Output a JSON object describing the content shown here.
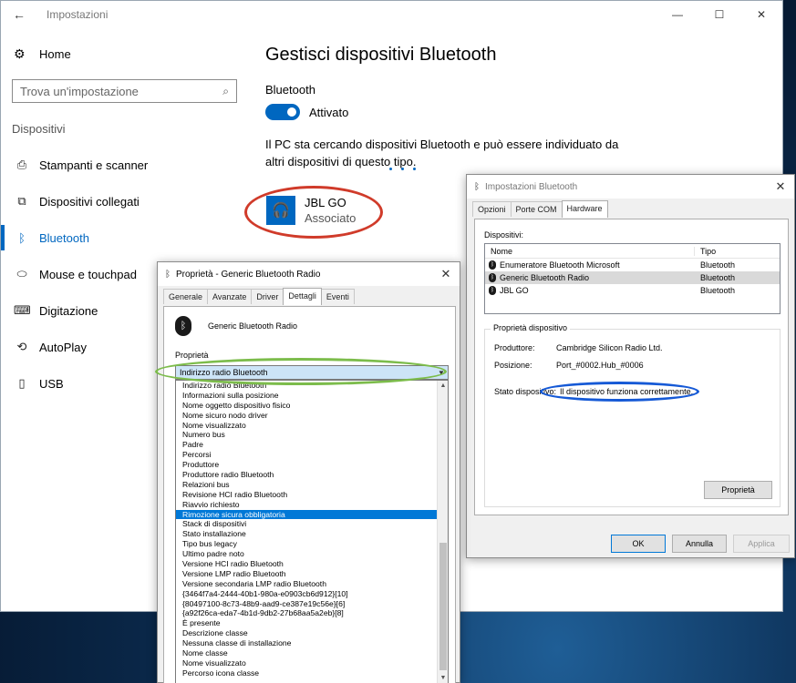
{
  "settings": {
    "window_title": "Impostazioni",
    "back": "←",
    "controls": {
      "minimize": "—",
      "maximize": "☐",
      "close": "✕"
    },
    "home": {
      "icon": "⚙",
      "label": "Home"
    },
    "search_placeholder": "Trova un'impostazione",
    "search_icon": "⌕",
    "section": "Dispositivi",
    "nav": [
      {
        "icon": "⎙",
        "label": "Stampanti e scanner"
      },
      {
        "icon": "⧉",
        "label": "Dispositivi collegati"
      },
      {
        "icon": "ᛒ",
        "label": "Bluetooth"
      },
      {
        "icon": "⬭",
        "label": "Mouse e touchpad"
      },
      {
        "icon": "⌨",
        "label": "Digitazione"
      },
      {
        "icon": "⟲",
        "label": "AutoPlay"
      },
      {
        "icon": "▯",
        "label": "USB"
      }
    ],
    "page_title": "Gestisci dispositivi Bluetooth",
    "bt_label": "Bluetooth",
    "toggle_state": "Attivato",
    "description": "Il PC sta cercando dispositivi Bluetooth e può essere individuato da altri dispositivi di questo tipo.",
    "device": {
      "icon": "🎧",
      "name": "JBL GO",
      "status": "Associato"
    },
    "accent": "#0067c0"
  },
  "bt_dialog": {
    "title": "Impostazioni Bluetooth",
    "tabs": [
      "Opzioni",
      "Porte COM",
      "Hardware"
    ],
    "devices_label": "Dispositivi:",
    "columns": [
      "Nome",
      "Tipo"
    ],
    "rows": [
      {
        "name": "Enumeratore Bluetooth Microsoft",
        "type": "Bluetooth"
      },
      {
        "name": "Generic Bluetooth Radio",
        "type": "Bluetooth"
      },
      {
        "name": "JBL GO",
        "type": "Bluetooth"
      }
    ],
    "props_legend": "Proprietà dispositivo",
    "manufacturer_label": "Produttore:",
    "manufacturer": "Cambridge Silicon Radio Ltd.",
    "position_label": "Posizione:",
    "position": "Port_#0002.Hub_#0006",
    "status_label": "Stato dispositivo:",
    "status": "Il dispositivo funziona correttamente.",
    "properties_button": "Proprietà",
    "ok": "OK",
    "cancel": "Annulla",
    "apply": "Applica"
  },
  "props_dialog": {
    "title": "Proprietà - Generic Bluetooth Radio",
    "tabs": [
      "Generale",
      "Avanzate",
      "Driver",
      "Dettagli",
      "Eventi"
    ],
    "device_name": "Generic Bluetooth Radio",
    "property_label": "Proprietà",
    "selected": "Indirizzo radio Bluetooth",
    "options": [
      "Indirizzo radio Bluetooth",
      "Informazioni sulla posizione",
      "Nome oggetto dispositivo fisico",
      "Nome sicuro nodo driver",
      "Nome visualizzato",
      "Numero bus",
      "Padre",
      "Percorsi",
      "Produttore",
      "Produttore radio Bluetooth",
      "Relazioni bus",
      "Revisione HCI radio Bluetooth",
      "Riavvio richiesto",
      "Rimozione sicura obbligatoria",
      "Stack di dispositivi",
      "Stato installazione",
      "Tipo bus legacy",
      "Ultimo padre noto",
      "Versione HCI radio Bluetooth",
      "Versione LMP radio Bluetooth",
      "Versione secondaria LMP radio Bluetooth",
      "{3464f7a4-2444-40b1-980a-e0903cb6d912}[10]",
      "{80497100-8c73-48b9-aad9-ce387e19c56e}[6]",
      "{a92f26ca-eda7-4b1d-9db2-27b68aa5a2eb}[8]",
      "È presente",
      "Descrizione classe",
      "Nessuna classe di installazione",
      "Nome classe",
      "Nome visualizzato",
      "Percorso icona classe"
    ],
    "highlighted": "Rimozione sicura obbligatoria"
  }
}
